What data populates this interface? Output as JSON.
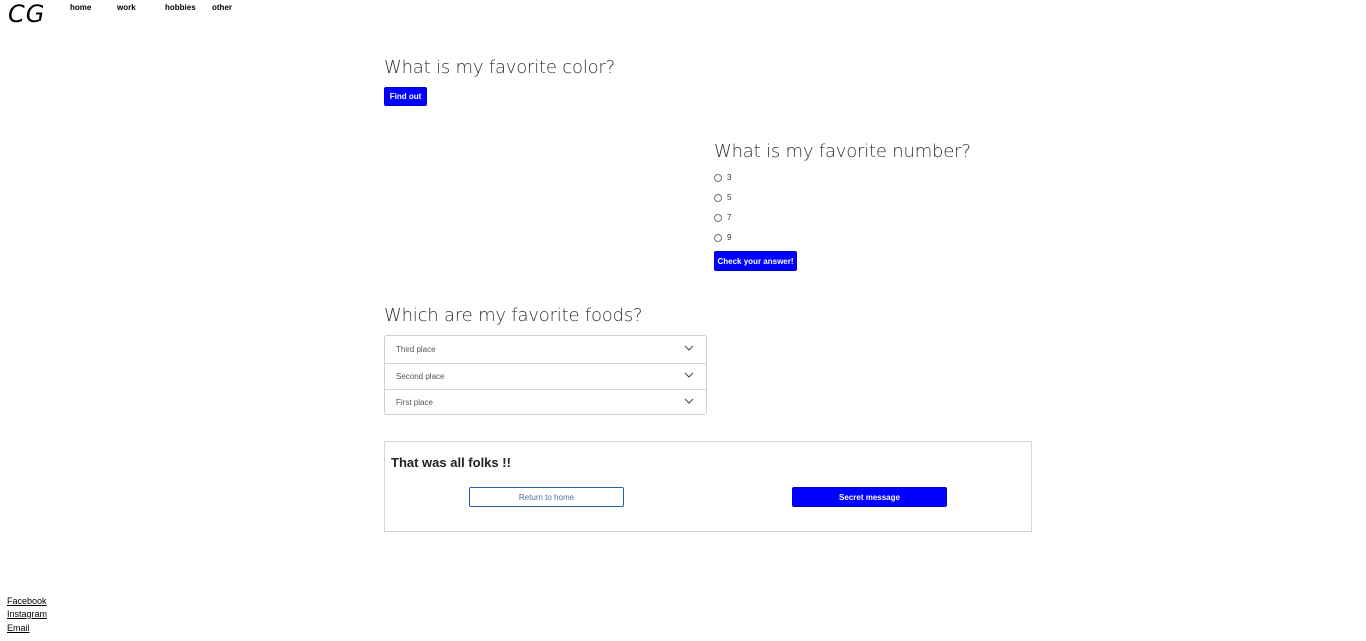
{
  "header": {
    "logo": "CG",
    "nav": [
      "home",
      "work",
      "hobbies",
      "other"
    ]
  },
  "color_question": {
    "title": "What is my favorite color?",
    "button_label": "Find out"
  },
  "number_question": {
    "title": "What is my favorite number?",
    "options": [
      "3",
      "5",
      "7",
      "9"
    ],
    "button_label": "Check your answer!"
  },
  "foods_question": {
    "title": "Which are my favorite foods?",
    "selects": [
      "Third place",
      "Second place",
      "First place"
    ]
  },
  "closing_card": {
    "title": "That was all folks !!",
    "return_label": "Return to home",
    "secret_label": "Secret message"
  },
  "footer": {
    "links": [
      "Facebook",
      "Instagram",
      "Email"
    ]
  },
  "colors": {
    "accent": "#0000ff",
    "outline": "#2d5fa8"
  }
}
